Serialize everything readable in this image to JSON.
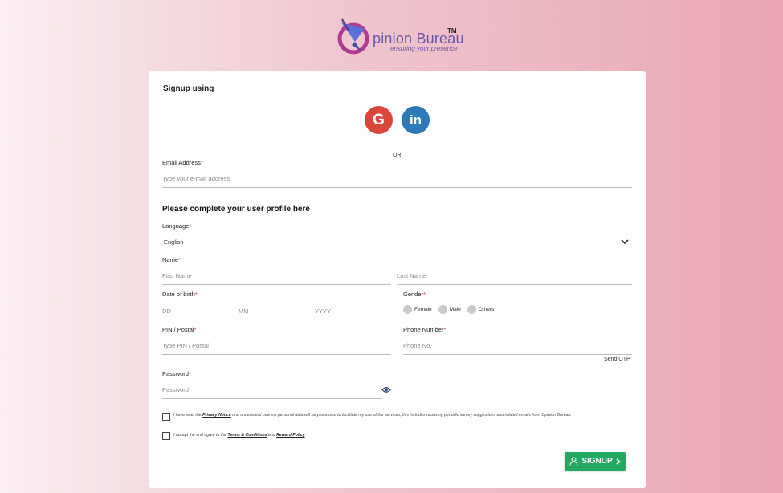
{
  "brand": {
    "name": "pinion Bureau",
    "tm": "TM",
    "tagline": "ensuring your presence"
  },
  "signup": {
    "title": "Signup using",
    "google_icon": "google-g-icon",
    "linkedin_icon": "linkedin-in-icon",
    "google_glyph": "G",
    "linkedin_glyph": "in",
    "or": "OR"
  },
  "email": {
    "label": "Email Address",
    "required_mark": "*",
    "placeholder": "Type your e-mail address"
  },
  "profile": {
    "heading": "Please complete your user profile here",
    "language": {
      "label": "Language",
      "required_mark": "*",
      "value": "English"
    },
    "name": {
      "label": "Name",
      "required_mark": "*",
      "first_placeholder": "First Name",
      "last_placeholder": "Last Name"
    },
    "dob": {
      "label": "Date of birth",
      "required_mark": "*",
      "dd": "DD",
      "mm": "MM",
      "yyyy": "YYYY"
    },
    "gender": {
      "label": "Gender",
      "required_mark": "*",
      "options": [
        "Female",
        "Male",
        "Others"
      ]
    },
    "pin": {
      "label": "PIN / Postal",
      "required_mark": "*",
      "placeholder": "Type PIN / Postal"
    },
    "phone": {
      "label": "Phone Number",
      "required_mark": "*",
      "placeholder": "Phone No.",
      "send_otp": "Send OTP"
    },
    "password": {
      "label": "Password",
      "required_mark": "*",
      "placeholder": "Password",
      "eye_icon": "eye-icon"
    }
  },
  "consent": {
    "privacy": {
      "prefix": "I have read the ",
      "link": "Privacy Notice",
      "suffix": " and understand how my personal data will be processed to facilitate my use of the services, this includes receiving periodic survey suggestions and related emails from Opinion Bureau."
    },
    "terms": {
      "prefix": "I accept the and agree to the ",
      "link1": "Terms & Conditions",
      "middle": " and ",
      "link2": "Reward Policy",
      "suffix": "."
    }
  },
  "button": {
    "label": "SIGNUP",
    "icon": "user-icon",
    "arrow": "chevron-right-icon"
  },
  "colors": {
    "google": "#d9473b",
    "linkedin": "#2b7bb9",
    "signup": "#22a860",
    "brand": "#6a5aa8"
  }
}
